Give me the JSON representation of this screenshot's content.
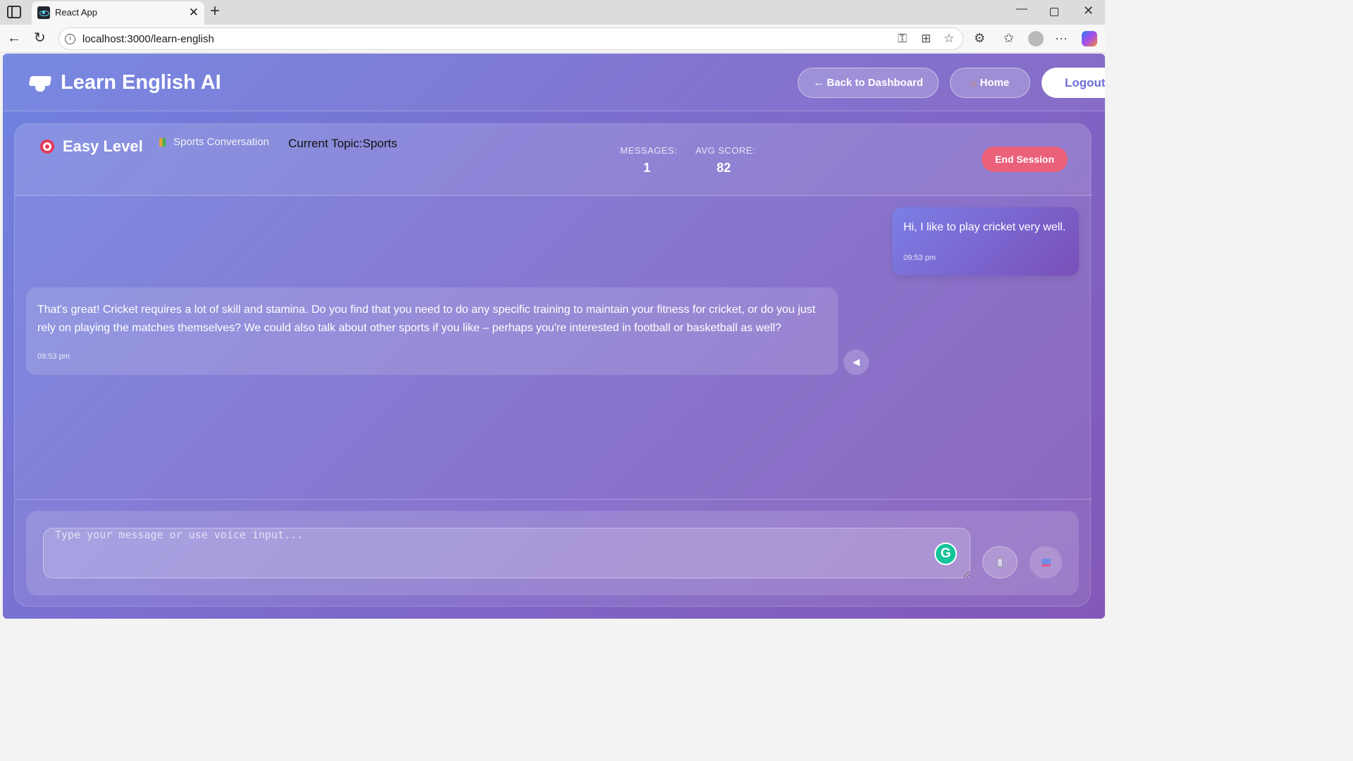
{
  "browser": {
    "tab_title": "React App",
    "url": "localhost:3000/learn-english",
    "close_glyph": "✕",
    "new_tab_glyph": "+"
  },
  "header": {
    "brand_title": "Learn English AI",
    "back_label": "← Back to Dashboard",
    "home_label": "Home",
    "logout_label": "Logout"
  },
  "session": {
    "level_label": "Easy Level",
    "conversation_label": "Sports Conversation",
    "topic_label": "Current Topic:Sports",
    "messages_label": "MESSAGES:",
    "messages_value": "1",
    "avg_score_label": "AVG SCORE:",
    "avg_score_value": "82",
    "end_label": "End Session"
  },
  "messages": [
    {
      "role": "user",
      "text": "Hi, I like to play cricket very well.",
      "time": "09:53 pm"
    },
    {
      "role": "assistant",
      "text": "That's great! Cricket requires a lot of skill and stamina. Do you find that you need to do any specific training to maintain your fitness for cricket, or do you just rely on playing the matches themselves? We could also talk about other sports if you like – perhaps you're interested in football or basketball as well?",
      "time": "09:53 pm"
    }
  ],
  "composer": {
    "placeholder": "Type your message or use voice input..."
  },
  "colors": {
    "accent": "#6b6fd6",
    "end_session": "#ea6179",
    "grammarly": "#15c39a"
  }
}
